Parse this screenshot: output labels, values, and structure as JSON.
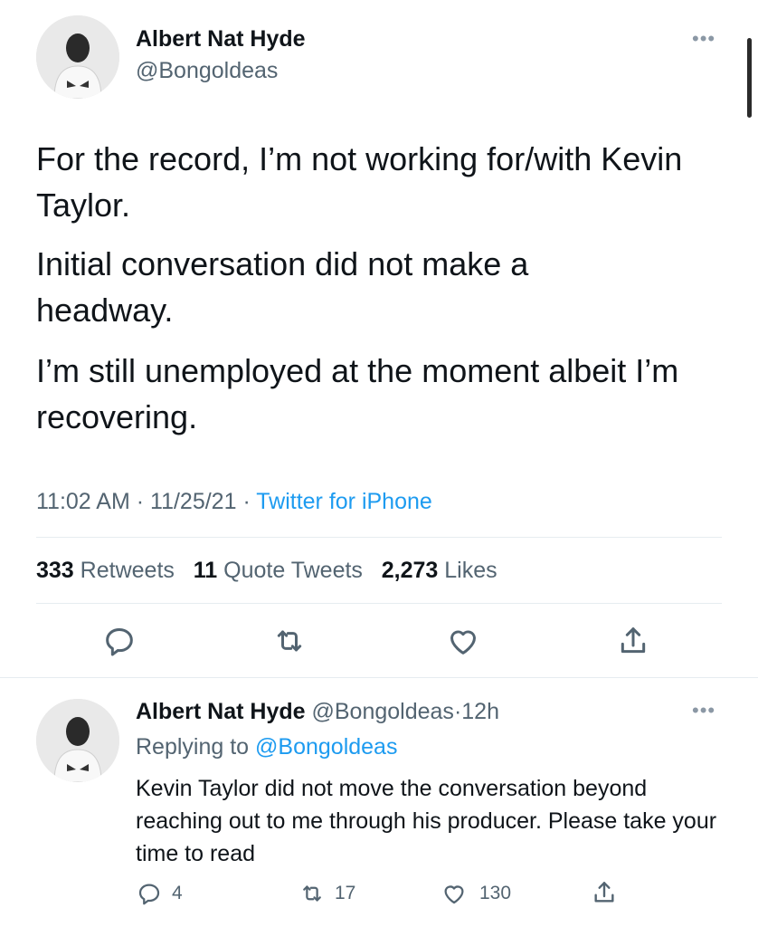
{
  "tweet": {
    "author_name": "Albert Nat Hyde",
    "author_handle": "@Bongoldeas",
    "more_label": "•••",
    "paragraphs": [
      "For the record, I’m not working for/with Kevin Taylor.",
      "Initial conversation did not make a headway.",
      "I’m still unemployed at the moment albeit I’m recovering."
    ],
    "time": "11:02 AM",
    "date": "11/25/21",
    "separator": "·",
    "source": "Twitter for iPhone",
    "retweets_count": "333",
    "retweets_label": "Retweets",
    "quotes_count": "11",
    "quotes_label": "Quote Tweets",
    "likes_count": "2,273",
    "likes_label": "Likes",
    "actions": [
      "reply-icon",
      "retweet-icon",
      "like-icon",
      "share-icon"
    ]
  },
  "reply": {
    "author_name": "Albert Nat Hyde",
    "author_handle": "@Bongoldeas",
    "separator": "·",
    "age": "12h",
    "more_label": "•••",
    "replying_prefix": "Replying to",
    "replying_handle": "@Bongoldeas",
    "text": "Kevin Taylor did not move the conversation beyond reaching out to me through his producer. Please take your time to read",
    "reply_count": "4",
    "retweet_count": "17",
    "like_count": "130"
  },
  "colors": {
    "text": "#0f1419",
    "muted": "#536471",
    "accent": "#1d9bf0",
    "divider": "#e6ecf0"
  }
}
